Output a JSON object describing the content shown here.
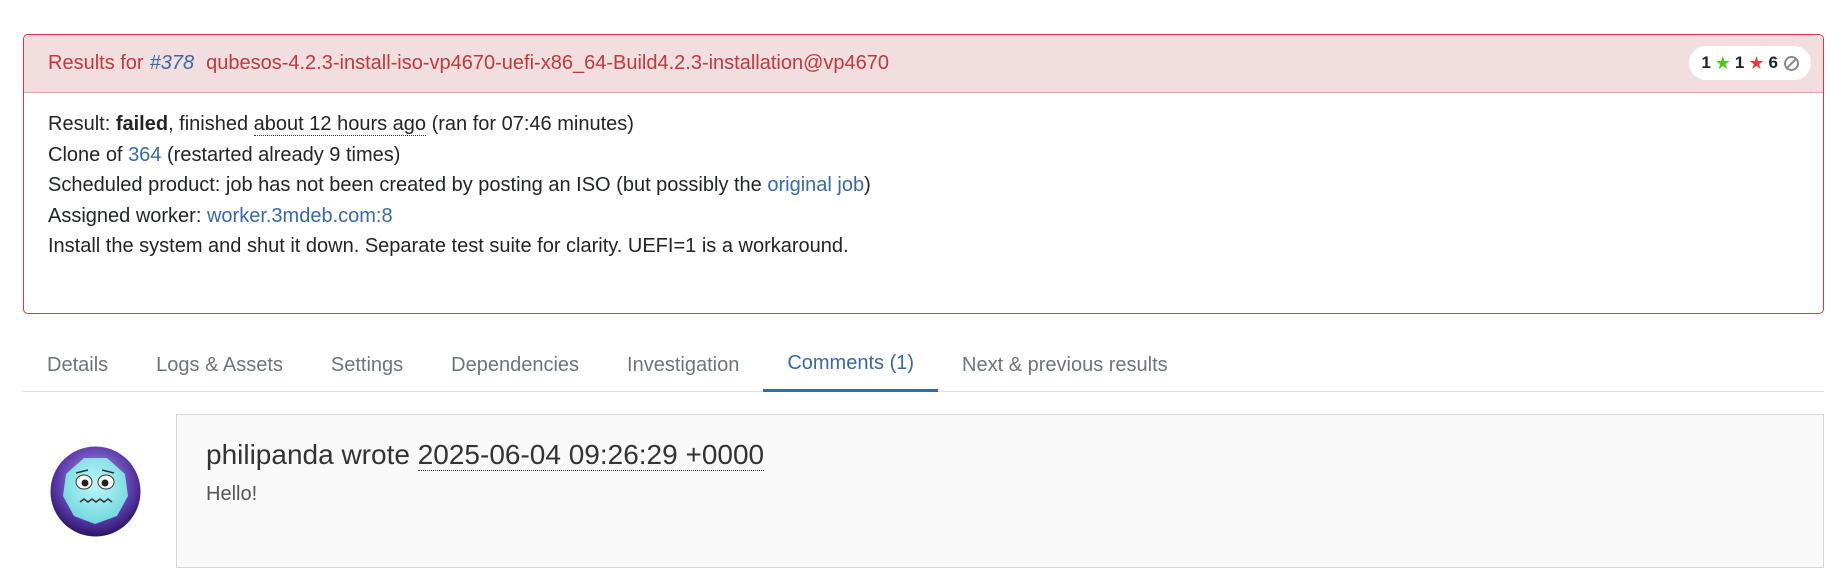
{
  "result_card": {
    "header_prefix": "Results for",
    "job_number": "#378",
    "job_name": "qubesos-4.2.3-install-iso-vp4670-uefi-x86_64-Build4.2.3-installation@vp4670",
    "badge": {
      "passed": "1",
      "softfailed": "1",
      "failed": "6"
    },
    "result_label": "Result: ",
    "result_value": "failed",
    "finished_text": ", finished ",
    "finished_relative": "about 12 hours ago",
    "duration_text": " (ran for 07:46 minutes)",
    "clone_prefix": "Clone of ",
    "clone_job": "364",
    "clone_suffix": " (restarted already 9 times)",
    "scheduled_prefix": "Scheduled product: job has not been created by posting an ISO (but possibly the ",
    "scheduled_link": "original job",
    "scheduled_suffix": ")",
    "worker_label": "Assigned worker: ",
    "worker": "worker.3mdeb.com:8",
    "description": "Install the system and shut it down. Separate test suite for clarity. UEFI=1 is a workaround."
  },
  "tabs": [
    {
      "label": "Details"
    },
    {
      "label": "Logs & Assets"
    },
    {
      "label": "Settings"
    },
    {
      "label": "Dependencies"
    },
    {
      "label": "Investigation"
    },
    {
      "label": "Comments (1)"
    },
    {
      "label": "Next & previous results"
    }
  ],
  "active_tab": "Comments (1)",
  "comment": {
    "author": "philipanda",
    "wrote": " wrote ",
    "timestamp": "2025-06-04 09:26:29 +0000",
    "text": "Hello!"
  },
  "colors": {
    "danger_border": "#dc3545",
    "header_bg": "#f2dede",
    "header_text": "#c0393b",
    "link": "#3769a8",
    "star_green": "#4cc71e",
    "star_red": "#e8413b"
  },
  "icons": {
    "passed": "star-icon",
    "softfailed": "star-icon",
    "skipped": "cancel-circle-icon",
    "avatar": "nervous-face-avatar"
  }
}
